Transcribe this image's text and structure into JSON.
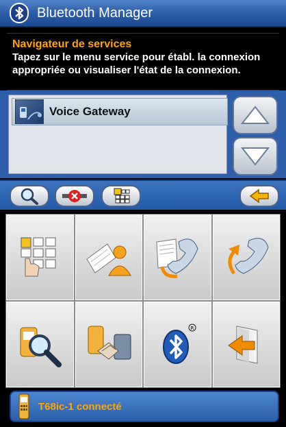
{
  "window": {
    "title": "Bluetooth Manager",
    "icon": "bluetooth-icon"
  },
  "info": {
    "title": "Navigateur de services",
    "description": "Tapez sur le menu service pour établ. la connexion appropriée ou visualiser l'état de la connexion."
  },
  "services": {
    "items": [
      {
        "label": "Voice Gateway",
        "icon": "phone-headset-icon"
      }
    ],
    "scroll_up_icon": "triangle-up-icon",
    "scroll_down_icon": "triangle-down-icon"
  },
  "toolbar": {
    "buttons": [
      {
        "icon": "magnifier-icon"
      },
      {
        "icon": "disconnect-icon"
      },
      {
        "icon": "menu-grid-icon"
      },
      {
        "icon": "back-arrow-icon"
      }
    ]
  },
  "grid": {
    "items": [
      {
        "icon": "keypad-icon"
      },
      {
        "icon": "contacts-icon"
      },
      {
        "icon": "call-log-icon"
      },
      {
        "icon": "redial-icon"
      },
      {
        "icon": "device-search-icon"
      },
      {
        "icon": "pairing-icon"
      },
      {
        "icon": "bluetooth-settings-icon"
      },
      {
        "icon": "exit-icon"
      }
    ]
  },
  "status": {
    "text": "T68ic-1 connecté",
    "icon": "phone-icon"
  }
}
